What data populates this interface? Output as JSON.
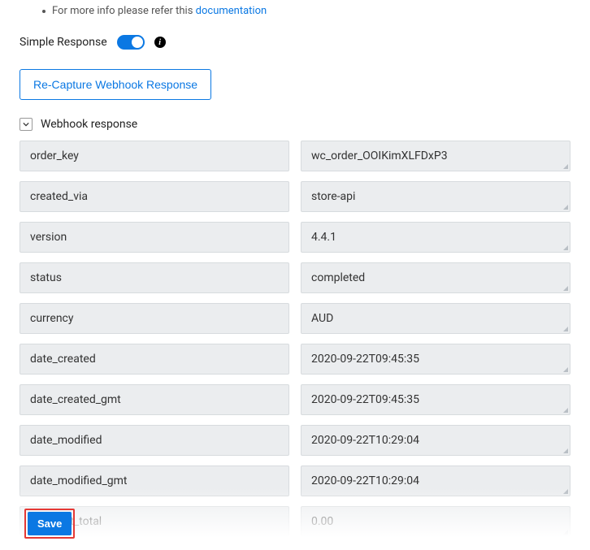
{
  "info": {
    "text": "For more info please refer this ",
    "link": "documentation"
  },
  "toggle": {
    "label": "Simple Response"
  },
  "recapture_label": "Re-Capture Webhook Response",
  "section_title": "Webhook response",
  "fields": [
    {
      "key": "order_key",
      "value": "wc_order_OOIKimXLFDxP3"
    },
    {
      "key": "created_via",
      "value": "store-api"
    },
    {
      "key": "version",
      "value": "4.4.1"
    },
    {
      "key": "status",
      "value": "completed"
    },
    {
      "key": "currency",
      "value": "AUD"
    },
    {
      "key": "date_created",
      "value": "2020-09-22T09:45:35"
    },
    {
      "key": "date_created_gmt",
      "value": "2020-09-22T09:45:35"
    },
    {
      "key": "date_modified",
      "value": "2020-09-22T10:29:04"
    },
    {
      "key": "date_modified_gmt",
      "value": "2020-09-22T10:29:04"
    },
    {
      "key": "discount_total",
      "value": "0.00"
    }
  ],
  "save_label": "Save"
}
